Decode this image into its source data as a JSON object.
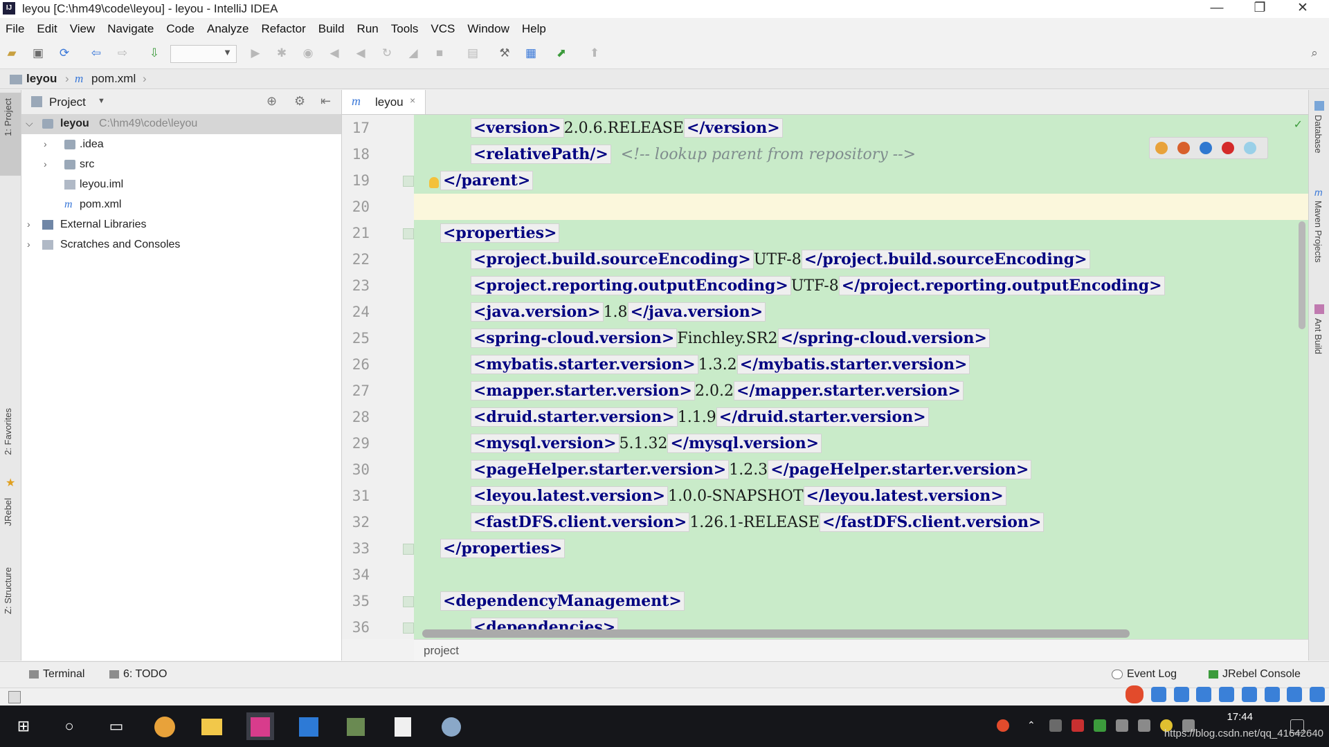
{
  "window": {
    "title": "leyou [C:\\hm49\\code\\leyou] - leyou - IntelliJ IDEA",
    "app_icon": "IJ",
    "controls": {
      "minimize": "—",
      "restore": "❐",
      "close": "✕"
    }
  },
  "menu": [
    "File",
    "Edit",
    "View",
    "Navigate",
    "Code",
    "Analyze",
    "Refactor",
    "Build",
    "Run",
    "Tools",
    "VCS",
    "Window",
    "Help"
  ],
  "toolbar_icons": [
    "open-icon",
    "save-icon",
    "sync-icon",
    "back-icon",
    "forward-icon",
    "build-icon",
    "run-config-dropdown",
    "run-icon",
    "debug-icon",
    "coverage-icon",
    "profile-icon",
    "step-icon",
    "rerun-icon",
    "update-icon",
    "stop-icon",
    "project-structure-icon",
    "sdk-icon",
    "jrebel-icon",
    "deploy-icon",
    "search-icon"
  ],
  "navbar": {
    "project": "leyou",
    "file": "pom.xml"
  },
  "left_stripe": {
    "project": "1: Project",
    "favorites": "2: Favorites",
    "jrebel": "JRebel",
    "structure": "Z: Structure"
  },
  "project_panel": {
    "header_label": "Project",
    "tree": [
      {
        "label": "leyou",
        "path": "C:\\hm49\\code\\leyou",
        "level": 0,
        "expanded": true,
        "type": "module"
      },
      {
        "label": ".idea",
        "level": 1,
        "expanded": false,
        "type": "folder"
      },
      {
        "label": "src",
        "level": 1,
        "expanded": false,
        "type": "folder"
      },
      {
        "label": "leyou.iml",
        "level": 1,
        "type": "file"
      },
      {
        "label": "pom.xml",
        "level": 1,
        "type": "maven"
      },
      {
        "label": "External Libraries",
        "level": 0,
        "expanded": false,
        "type": "library"
      },
      {
        "label": "Scratches and Consoles",
        "level": 0,
        "expanded": false,
        "type": "scratch"
      }
    ]
  },
  "editor": {
    "tab": {
      "icon": "m",
      "label": "leyou",
      "close": "×"
    },
    "breadcrumb": "project",
    "lines": [
      {
        "n": "17",
        "indent": 2,
        "open": "<version>",
        "value": "2.0.6.RELEASE",
        "close": "</version>"
      },
      {
        "n": "18",
        "indent": 2,
        "open": "<relativePath/>",
        "comment": "<!-- lookup parent from repository -->"
      },
      {
        "n": "19",
        "indent": 1,
        "open": "</parent>"
      },
      {
        "n": "20",
        "indent": 0,
        "current": true
      },
      {
        "n": "21",
        "indent": 1,
        "open": "<properties>"
      },
      {
        "n": "22",
        "indent": 2,
        "open": "<project.build.sourceEncoding>",
        "value": "UTF-8",
        "close": "</project.build.sourceEncoding>"
      },
      {
        "n": "23",
        "indent": 2,
        "open": "<project.reporting.outputEncoding>",
        "value": "UTF-8",
        "close": "</project.reporting.outputEncoding>"
      },
      {
        "n": "24",
        "indent": 2,
        "open": "<java.version>",
        "value": "1.8",
        "close": "</java.version>"
      },
      {
        "n": "25",
        "indent": 2,
        "open": "<spring-cloud.version>",
        "value": "Finchley.SR2",
        "close": "</spring-cloud.version>"
      },
      {
        "n": "26",
        "indent": 2,
        "open": "<mybatis.starter.version>",
        "value": "1.3.2",
        "close": "</mybatis.starter.version>"
      },
      {
        "n": "27",
        "indent": 2,
        "open": "<mapper.starter.version>",
        "value": "2.0.2",
        "close": "</mapper.starter.version>"
      },
      {
        "n": "28",
        "indent": 2,
        "open": "<druid.starter.version>",
        "value": "1.1.9",
        "close": "</druid.starter.version>"
      },
      {
        "n": "29",
        "indent": 2,
        "open": "<mysql.version>",
        "value": "5.1.32",
        "close": "</mysql.version>"
      },
      {
        "n": "30",
        "indent": 2,
        "open": "<pageHelper.starter.version>",
        "value": "1.2.3",
        "close": "</pageHelper.starter.version>"
      },
      {
        "n": "31",
        "indent": 2,
        "open": "<leyou.latest.version>",
        "value": "1.0.0-SNAPSHOT",
        "close": "</leyou.latest.version>"
      },
      {
        "n": "32",
        "indent": 2,
        "open": "<fastDFS.client.version>",
        "value": "1.26.1-RELEASE",
        "close": "</fastDFS.client.version>"
      },
      {
        "n": "33",
        "indent": 1,
        "open": "</properties>"
      },
      {
        "n": "34",
        "indent": 0
      },
      {
        "n": "35",
        "indent": 1,
        "open": "<dependencyManagement>"
      },
      {
        "n": "36",
        "indent": 2,
        "open": "<dependencies>"
      }
    ]
  },
  "right_stripe": {
    "database": "Database",
    "maven": "Maven Projects",
    "ant": "Ant Build"
  },
  "bottom_tools": {
    "terminal": "Terminal",
    "todo": "6: TODO",
    "event_log": "Event Log",
    "jrebel_console": "JRebel Console"
  },
  "taskbar": {
    "clock_time": "17:44",
    "watermark": "https://blog.csdn.net/qq_41642640"
  },
  "colors": {
    "editor_bg": "#c9ebc9",
    "tag": "#000080",
    "current_line": "#fbf7dc",
    "accent": "#3a78d8"
  }
}
